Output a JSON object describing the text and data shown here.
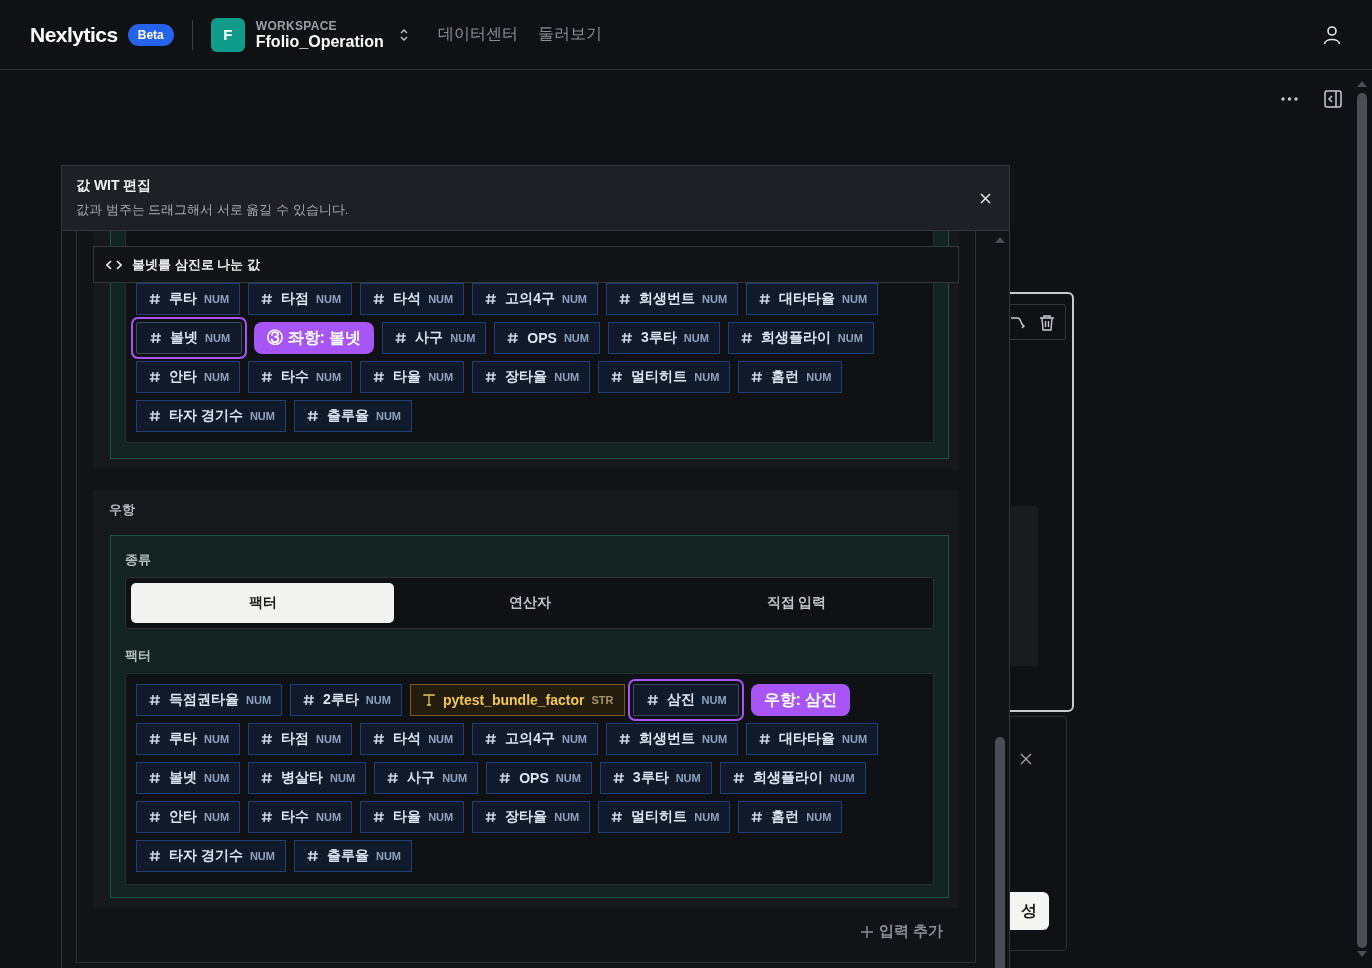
{
  "nav": {
    "brand": "Nexlytics",
    "badge": "Beta",
    "workspace_initial": "F",
    "workspace_label": "WORKSPACE",
    "workspace_name": "Ffolio_Operation",
    "links": [
      "데이터센터",
      "둘러보기"
    ]
  },
  "background": {
    "button": "성"
  },
  "modal": {
    "title": "값 WIT 편집",
    "subtitle": "값과 범주는 드래그해서 서로 옮길 수 있습니다.",
    "sticky_header": "볼넷를 삼진로 나눈 값",
    "left_operand": {
      "rows": [
        {
          "kind": "num",
          "label": "루타",
          "type": "NUM",
          "selected": false
        },
        {
          "kind": "num",
          "label": "타점",
          "type": "NUM",
          "selected": false
        },
        {
          "kind": "num",
          "label": "타석",
          "type": "NUM",
          "selected": false
        },
        {
          "kind": "num",
          "label": "고의4구",
          "type": "NUM",
          "selected": false
        },
        {
          "kind": "num",
          "label": "희생번트",
          "type": "NUM",
          "selected": false
        },
        {
          "kind": "num",
          "label": "대타타율",
          "type": "NUM",
          "selected": false
        },
        {
          "kind": "num",
          "label": "볼넷",
          "type": "NUM",
          "selected": true
        },
        {
          "kind": "badge",
          "label": "③ 좌항: 볼넷"
        },
        {
          "kind": "num",
          "label": "사구",
          "type": "NUM",
          "selected": false
        },
        {
          "kind": "num",
          "label": "OPS",
          "type": "NUM",
          "selected": false
        },
        {
          "kind": "num",
          "label": "3루타",
          "type": "NUM",
          "selected": false
        },
        {
          "kind": "num",
          "label": "희생플라이",
          "type": "NUM",
          "selected": false
        },
        {
          "kind": "num",
          "label": "안타",
          "type": "NUM",
          "selected": false
        },
        {
          "kind": "num",
          "label": "타수",
          "type": "NUM",
          "selected": false
        },
        {
          "kind": "num",
          "label": "타율",
          "type": "NUM",
          "selected": false
        },
        {
          "kind": "num",
          "label": "장타율",
          "type": "NUM",
          "selected": false
        },
        {
          "kind": "num",
          "label": "멀티히트",
          "type": "NUM",
          "selected": false
        },
        {
          "kind": "num",
          "label": "홈런",
          "type": "NUM",
          "selected": false
        },
        {
          "kind": "num",
          "label": "타자 경기수",
          "type": "NUM",
          "selected": false
        },
        {
          "kind": "num",
          "label": "출루율",
          "type": "NUM",
          "selected": false
        }
      ]
    },
    "right_operand": {
      "label": "우항",
      "type_label": "종류",
      "segments": [
        {
          "label": "팩터",
          "selected": true
        },
        {
          "label": "연산자",
          "selected": false
        },
        {
          "label": "직접 입력",
          "selected": false
        }
      ],
      "factor_label": "팩터",
      "rows": [
        {
          "kind": "num",
          "label": "득점권타율",
          "type": "NUM",
          "selected": false
        },
        {
          "kind": "num",
          "label": "2루타",
          "type": "NUM",
          "selected": false
        },
        {
          "kind": "str",
          "label": "pytest_bundle_factor",
          "type": "STR",
          "selected": false
        },
        {
          "kind": "num",
          "label": "삼진",
          "type": "NUM",
          "selected": true
        },
        {
          "kind": "badge",
          "label": "우항: 삼진"
        },
        {
          "kind": "num",
          "label": "루타",
          "type": "NUM",
          "selected": false
        },
        {
          "kind": "num",
          "label": "타점",
          "type": "NUM",
          "selected": false
        },
        {
          "kind": "num",
          "label": "타석",
          "type": "NUM",
          "selected": false
        },
        {
          "kind": "num",
          "label": "고의4구",
          "type": "NUM",
          "selected": false
        },
        {
          "kind": "num",
          "label": "희생번트",
          "type": "NUM",
          "selected": false
        },
        {
          "kind": "num",
          "label": "대타타율",
          "type": "NUM",
          "selected": false
        },
        {
          "kind": "num",
          "label": "볼넷",
          "type": "NUM",
          "selected": false
        },
        {
          "kind": "num",
          "label": "병살타",
          "type": "NUM",
          "selected": false
        },
        {
          "kind": "num",
          "label": "사구",
          "type": "NUM",
          "selected": false
        },
        {
          "kind": "num",
          "label": "OPS",
          "type": "NUM",
          "selected": false
        },
        {
          "kind": "num",
          "label": "3루타",
          "type": "NUM",
          "selected": false
        },
        {
          "kind": "num",
          "label": "희생플라이",
          "type": "NUM",
          "selected": false
        },
        {
          "kind": "num",
          "label": "안타",
          "type": "NUM",
          "selected": false
        },
        {
          "kind": "num",
          "label": "타수",
          "type": "NUM",
          "selected": false
        },
        {
          "kind": "num",
          "label": "타율",
          "type": "NUM",
          "selected": false
        },
        {
          "kind": "num",
          "label": "장타율",
          "type": "NUM",
          "selected": false
        },
        {
          "kind": "num",
          "label": "멀티히트",
          "type": "NUM",
          "selected": false
        },
        {
          "kind": "num",
          "label": "홈런",
          "type": "NUM",
          "selected": false
        },
        {
          "kind": "num",
          "label": "타자 경기수",
          "type": "NUM",
          "selected": false
        },
        {
          "kind": "num",
          "label": "출루율",
          "type": "NUM",
          "selected": false
        }
      ]
    },
    "add_input": "입력 추가"
  }
}
